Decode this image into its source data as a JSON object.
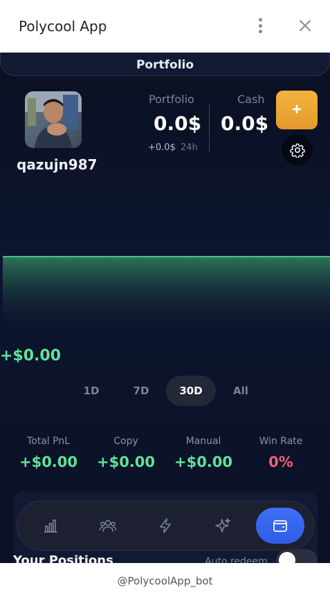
{
  "window": {
    "title": "Polycool App",
    "footer_text": "@PolycoolApp_bot",
    "more_icon": "vertical-dots-icon",
    "close_icon": "close-icon"
  },
  "header": {
    "tab_label": "Portfolio"
  },
  "profile": {
    "username": "qazujn987",
    "avatar": "user-avatar-photo"
  },
  "portfolio": {
    "label": "Portfolio",
    "value": "0.0$",
    "change": "+0.0$",
    "change_period": "24h"
  },
  "cash": {
    "label": "Cash",
    "value": "0.0$"
  },
  "actions": {
    "deposit_label": "+",
    "settings_icon": "gear-icon"
  },
  "pnl": {
    "value": "+$0.00",
    "color": "#5fe39a"
  },
  "ranges": {
    "items": [
      "1D",
      "7D",
      "30D",
      "All"
    ],
    "active": "30D"
  },
  "metrics": [
    {
      "label": "Total PnL",
      "value": "+$0.00",
      "color": "#5fe39a"
    },
    {
      "label": "Copy",
      "value": "+$0.00",
      "color": "#5fe39a"
    },
    {
      "label": "Manual",
      "value": "+$0.00",
      "color": "#5fe39a"
    },
    {
      "label": "Win Rate",
      "value": "0%",
      "color": "#f06078"
    }
  ],
  "nav": {
    "items": [
      {
        "icon": "bar-chart-icon"
      },
      {
        "icon": "users-icon"
      },
      {
        "icon": "lightning-icon"
      },
      {
        "icon": "sparkle-icon"
      },
      {
        "icon": "wallet-icon",
        "active": true
      }
    ]
  },
  "positions": {
    "title": "Your Positions",
    "auto_redeem_label": "Auto redeem",
    "auto_redeem_on": false
  },
  "colors": {
    "accent_orange": "#f3b23f",
    "accent_blue": "#3f6ff5",
    "positive": "#5fe39a",
    "negative": "#f06078"
  }
}
